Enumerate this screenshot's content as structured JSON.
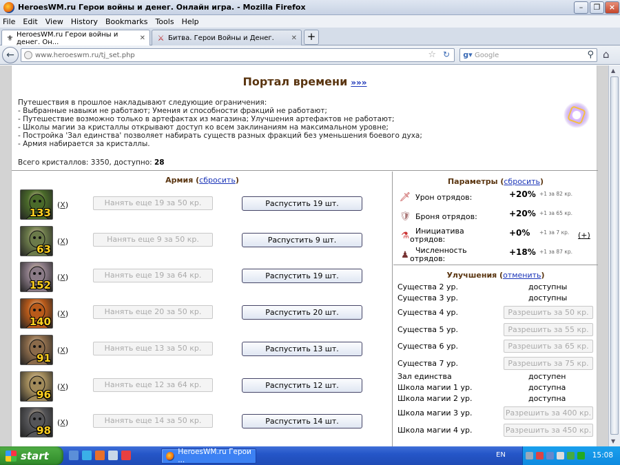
{
  "window": {
    "title": "HeroesWM.ru Герои войны и денег. Онлайн игра. - Mozilla Firefox"
  },
  "menu": [
    "File",
    "Edit",
    "View",
    "History",
    "Bookmarks",
    "Tools",
    "Help"
  ],
  "tabs": [
    {
      "label": "HeroesWM.ru Герои войны и денег. Он..."
    },
    {
      "label": "Битва. Герои Войны и Денег."
    }
  ],
  "nav": {
    "url": "www.heroeswm.ru/tj_set.php",
    "search_placeholder": "Google"
  },
  "page": {
    "title": "Портал времени",
    "title_link": "»»»",
    "rules": [
      "Путешествия в прошлое накладывают следующие ограничения:",
      "- Выбранные навыки не работают; Умения и способности фракций не работают;",
      "- Путешествие возможно только в артефактах из магазина; Улучшения артефактов не работают;",
      "- Школы магии за кристаллы открывают доступ ко всем заклинаниям на максимальном уровне;",
      "- Постройка 'Зал единства' позволяет набирать существ разных фракций без уменьшения боевого духа;",
      "- Армия набирается за кристаллы."
    ],
    "crystals_text": "Всего кристаллов: 3350, доступно:",
    "crystals_avail": "28"
  },
  "army": {
    "heading": "Армия",
    "reset": "сбросить",
    "remove_label": "X",
    "units": [
      {
        "count": "133",
        "hire": "Нанять еще 19 за 50 кр.",
        "dismiss": "Распустить 19 шт.",
        "color": "#4a6a2a"
      },
      {
        "count": "63",
        "hire": "Нанять еще 9 за 50 кр.",
        "dismiss": "Распустить 9 шт.",
        "color": "#6b7a4a"
      },
      {
        "count": "152",
        "hire": "Нанять еще 19 за 64 кр.",
        "dismiss": "Распустить 19 шт.",
        "color": "#8a7a86"
      },
      {
        "count": "140",
        "hire": "Нанять еще 20 за 50 кр.",
        "dismiss": "Распустить 20 шт.",
        "color": "#b85a1a"
      },
      {
        "count": "91",
        "hire": "Нанять еще 13 за 50 кр.",
        "dismiss": "Распустить 13 шт.",
        "color": "#8a6a4a"
      },
      {
        "count": "96",
        "hire": "Нанять еще 12 за 64 кр.",
        "dismiss": "Распустить 12 шт.",
        "color": "#a08a5a"
      },
      {
        "count": "98",
        "hire": "Нанять еще 14 за 50 кр.",
        "dismiss": "Распустить 14 шт.",
        "color": "#555558"
      }
    ]
  },
  "params": {
    "heading": "Параметры",
    "reset": "сбросить",
    "items": [
      {
        "label": [
          "Урон отрядов:"
        ],
        "value": "+20%",
        "sub": "+1 за 82 кр.",
        "icon": "sword-icon"
      },
      {
        "label": [
          "Броня отрядов:"
        ],
        "value": "+20%",
        "sub": "+1 за 65 кр.",
        "icon": "armor-icon"
      },
      {
        "label": [
          "Инициатива",
          "отрядов:"
        ],
        "value": "+0%",
        "sub": "+1 за 7 кр.",
        "icon": "initiative-icon",
        "plus": "+"
      },
      {
        "label": [
          "Численность",
          "отрядов:"
        ],
        "value": "+18%",
        "sub": "+1 за 87 кр.",
        "icon": "troops-icon"
      }
    ]
  },
  "upgrades": {
    "heading": "Улучшения",
    "cancel": "отменить",
    "items": [
      {
        "label": "Существа 2 ур.",
        "status": "доступны"
      },
      {
        "label": "Существа 3 ур.",
        "status": "доступны"
      },
      {
        "label": "Существа 4 ур.",
        "button": "Разрешить за 50 кр."
      },
      {
        "label": "Существа 5 ур.",
        "button": "Разрешить за 55 кр."
      },
      {
        "label": "Существа 6 ур.",
        "button": "Разрешить за 65 кр."
      },
      {
        "label": "Существа 7 ур.",
        "button": "Разрешить за 75 кр."
      },
      {
        "label": "Зал единства",
        "status": "доступен"
      },
      {
        "label": "Школа магии 1 ур.",
        "status": "доступна"
      },
      {
        "label": "Школа магии 2 ур.",
        "status": "доступна"
      },
      {
        "label": "Школа магии 3 ур.",
        "button": "Разрешить за 400 кр."
      },
      {
        "label": "Школа магии 4 ур.",
        "button": "Разрешить за 450 кр."
      }
    ]
  },
  "taskbar": {
    "start": "start",
    "task": "HeroesWM.ru Герои ...",
    "lang": "EN",
    "clock": "15:08"
  }
}
